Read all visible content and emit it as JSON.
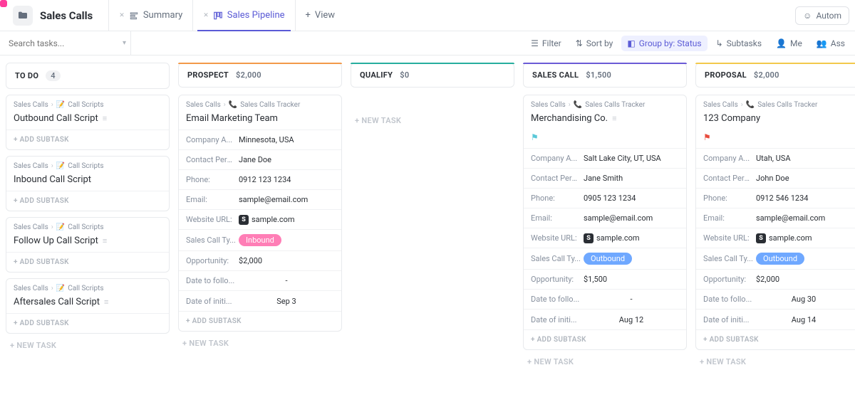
{
  "header": {
    "title": "Sales Calls",
    "tabs": {
      "summary": "Summary",
      "pipeline": "Sales Pipeline",
      "addview": "View"
    },
    "autom": "Autom"
  },
  "filterbar": {
    "search_placeholder": "Search tasks...",
    "filter": "Filter",
    "sort": "Sort by",
    "group": "Group by: Status",
    "subtasks": "Subtasks",
    "me": "Me",
    "assignee": "Ass"
  },
  "common": {
    "add_subtask": "+ ADD SUBTASK",
    "new_task": "+ NEW TASK",
    "crumb_root": "Sales Calls",
    "crumb_scripts": "Call Scripts",
    "crumb_tracker": "Sales Calls Tracker"
  },
  "fields": {
    "company": "Company A...",
    "contact": "Contact Pers...",
    "phone": "Phone:",
    "email": "Email:",
    "website": "Website URL:",
    "calltype": "Sales Call Ty...",
    "opportunity": "Opportunity:",
    "followup": "Date to follo...",
    "initiated": "Date of initi..."
  },
  "columns": {
    "todo": {
      "label": "TO DO",
      "count": "4",
      "cards": [
        {
          "title": "Outbound Call Script"
        },
        {
          "title": "Inbound Call Script"
        },
        {
          "title": "Follow Up Call Script"
        },
        {
          "title": "Aftersales Call Script"
        }
      ]
    },
    "prospect": {
      "label": "PROSPECT",
      "amount": "$2,000",
      "card": {
        "title": "Email Marketing Team",
        "company": "Minnesota, USA",
        "contact": "Jane Doe",
        "phone": "0912 123 1234",
        "email": "sample@email.com",
        "website": "sample.com",
        "calltype": "Inbound",
        "opportunity": "$2,000",
        "followup": "-",
        "initiated": "Sep 3"
      }
    },
    "qualify": {
      "label": "QUALIFY",
      "amount": "$0"
    },
    "salescall": {
      "label": "SALES CALL",
      "amount": "$1,500",
      "card": {
        "title": "Merchandising Co.",
        "company": "Salt Lake City, UT, USA",
        "contact": "Jane Smith",
        "phone": "0905 123 1234",
        "email": "sample@email.com",
        "website": "sample.com",
        "calltype": "Outbound",
        "opportunity": "$1,500",
        "followup": "-",
        "initiated": "Aug 12"
      }
    },
    "proposal": {
      "label": "PROPOSAL",
      "amount": "$2,000",
      "card": {
        "title": "123 Company",
        "company": "Utah, USA",
        "contact": "John Doe",
        "phone": "0912 546 1234",
        "email": "sample@email.com",
        "website": "sample.com",
        "calltype": "Outbound",
        "opportunity": "$2,000",
        "followup": "Aug 30",
        "initiated": "Aug 14"
      }
    }
  }
}
